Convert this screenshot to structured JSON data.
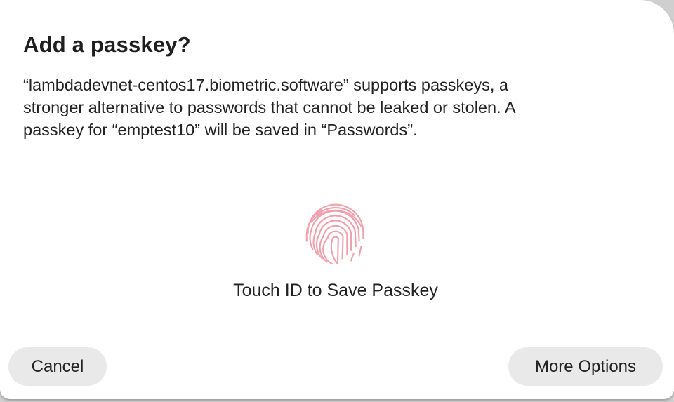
{
  "dialog": {
    "title": "Add a passkey?",
    "message_lines": [
      "“lambdadevnet-centos17.biometric.software” supports passkeys, a",
      "stronger alternative to passwords that cannot be leaked or stolen. A",
      "passkey for “emptest10” will be saved in “Passwords”."
    ],
    "touch_id_label": "Touch ID to Save Passkey",
    "icon": "fingerprint-icon",
    "icon_color": "#f0a0ac"
  },
  "buttons": {
    "cancel_label": "Cancel",
    "more_options_label": "More Options"
  }
}
